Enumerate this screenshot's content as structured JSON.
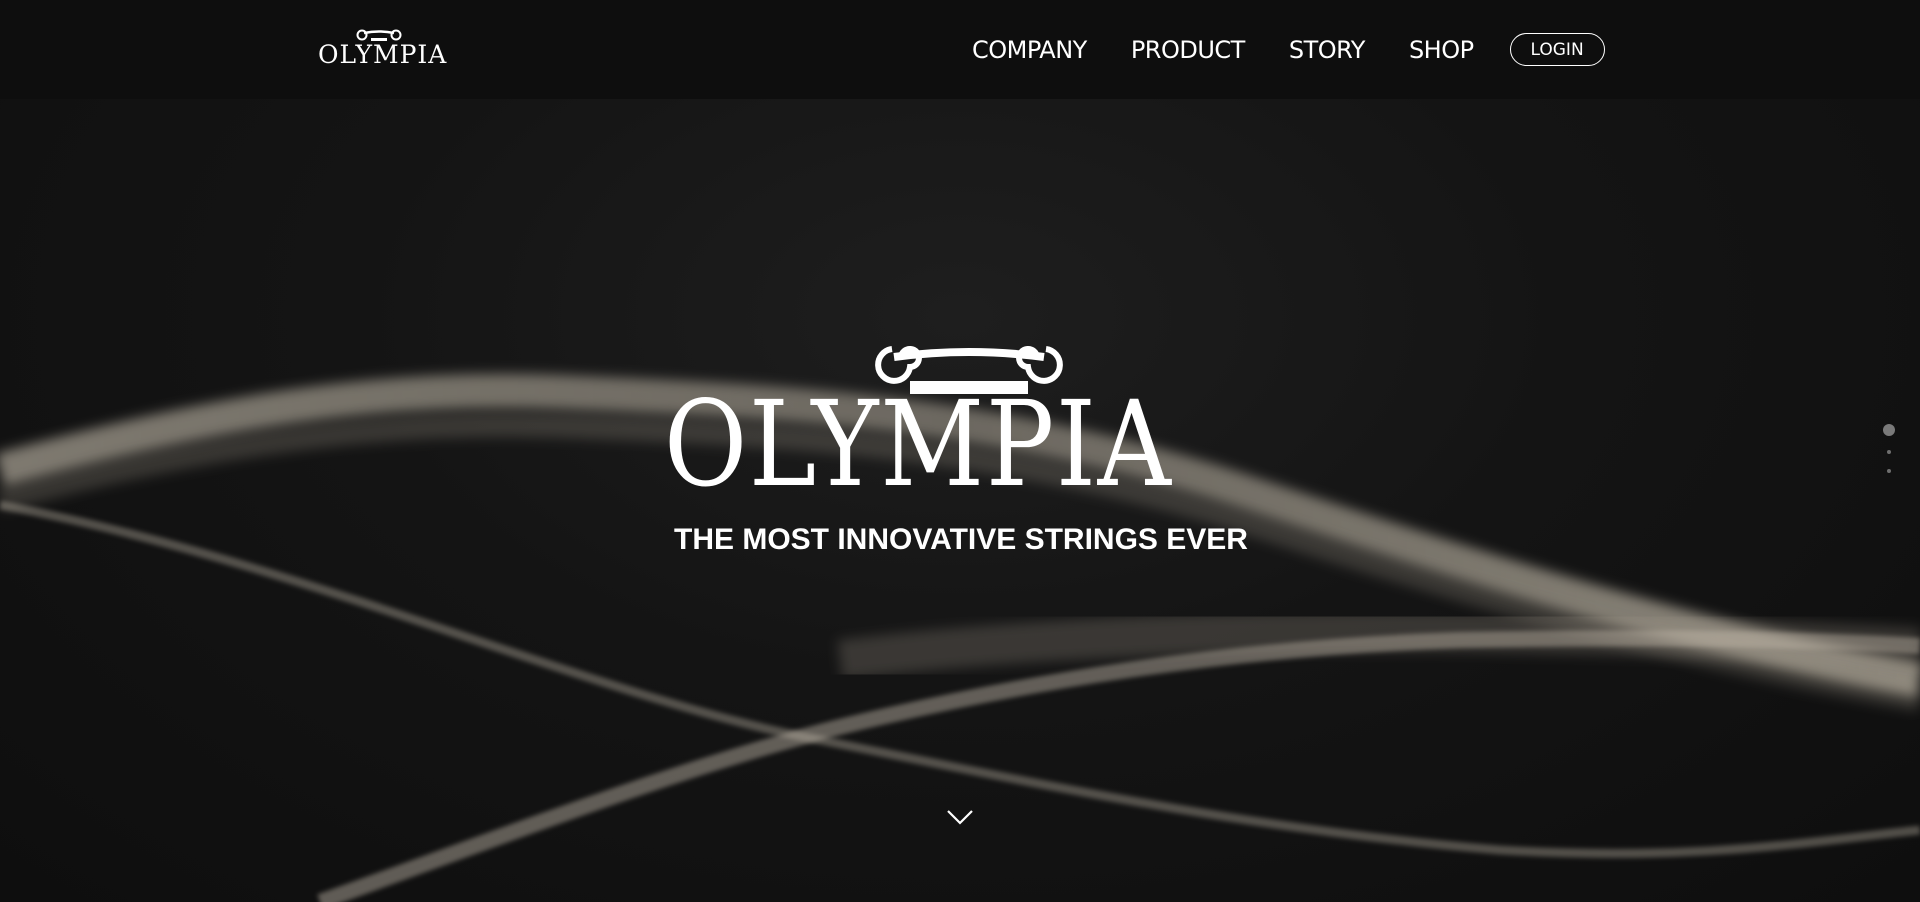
{
  "brand": {
    "logo_text": "OLYMPIA",
    "logo_icon": "ionic-column-capital-icon"
  },
  "nav": {
    "items": [
      {
        "label": "COMPANY"
      },
      {
        "label": "PRODUCT"
      },
      {
        "label": "STORY"
      },
      {
        "label": "SHOP"
      }
    ],
    "login_label": "LOGIN"
  },
  "hero": {
    "logo_text": "OLYMPIA",
    "tagline": "THE MOST INNOVATIVE STRINGS EVER",
    "background": "dark-strings-photo",
    "scroll_icon": "chevron-down-icon",
    "slides_total": 3,
    "active_slide": 1
  },
  "colors": {
    "navbar_bg": "#0e0e0e",
    "hero_bg": "#141414",
    "text": "#ffffff",
    "string_highlight": "#cfc6b4",
    "pager_dot": "#6e6e6e"
  }
}
